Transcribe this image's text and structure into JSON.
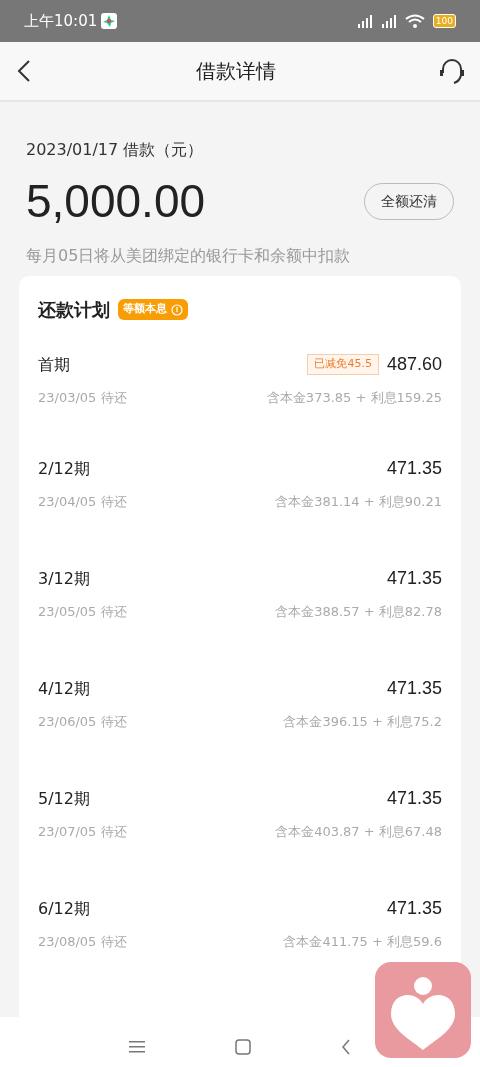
{
  "status_bar": {
    "time": "上午10:01",
    "battery": "100"
  },
  "header": {
    "title": "借款详情"
  },
  "loan": {
    "date_label": "2023/01/17 借款（元）",
    "amount": "5,000.00",
    "payoff_button": "全额还清",
    "note": "每月05日将从美团绑定的银行卡和余额中扣款"
  },
  "plan": {
    "title": "还款计划",
    "method_badge": "等额本息",
    "installments": [
      {
        "period": "首期",
        "amount": "487.60",
        "due": "23/03/05 待还",
        "breakdown": "含本金373.85 + 利息159.25",
        "discount": "已减免45.5"
      },
      {
        "period": "2/12期",
        "amount": "471.35",
        "due": "23/04/05 待还",
        "breakdown": "含本金381.14 + 利息90.21"
      },
      {
        "period": "3/12期",
        "amount": "471.35",
        "due": "23/05/05 待还",
        "breakdown": "含本金388.57 + 利息82.78"
      },
      {
        "period": "4/12期",
        "amount": "471.35",
        "due": "23/06/05 待还",
        "breakdown": "含本金396.15 + 利息75.2"
      },
      {
        "period": "5/12期",
        "amount": "471.35",
        "due": "23/07/05 待还",
        "breakdown": "含本金403.87 + 利息67.48"
      },
      {
        "period": "6/12期",
        "amount": "471.35",
        "due": "23/08/05 待还",
        "breakdown": "含本金411.75 + 利息59.6"
      }
    ]
  }
}
